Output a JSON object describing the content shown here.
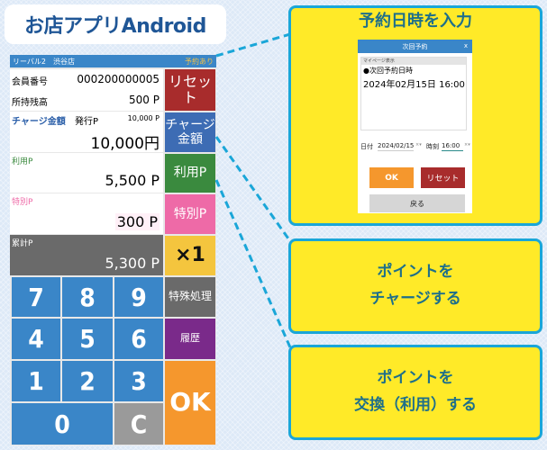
{
  "title": "お店アプリAndroid",
  "app": {
    "header": {
      "store": "リーバル2　渋谷店",
      "badge": "予約あり"
    },
    "member": {
      "member_no_label": "会員番号",
      "member_no": "000200000005",
      "balance_label": "所持残高",
      "balance": "500 P"
    },
    "charge": {
      "label": "チャージ金額",
      "issued_label": "発行P",
      "issued_value": "10,000 P",
      "amount": "10,000円"
    },
    "use": {
      "label": "利用P",
      "value": "5,500 P"
    },
    "special": {
      "label": "特別P",
      "value": "300 P"
    },
    "total": {
      "label": "累計P",
      "value": "5,300 P"
    },
    "side_buttons": {
      "reset": "リセット",
      "charge_line1": "チャージ",
      "charge_line2": "金額",
      "use": "利用P",
      "special": "特別P",
      "multiplier": "×1",
      "special_processing": "特殊処理",
      "history": "履歴",
      "ok": "OK"
    },
    "keypad": [
      "7",
      "8",
      "9",
      "4",
      "5",
      "6",
      "1",
      "2",
      "3",
      "0",
      "C"
    ]
  },
  "callouts": {
    "reservation": {
      "title": "予約日時を入力",
      "dialog": {
        "title": "次回予約",
        "close": "x",
        "caption": "マイページ表示",
        "line1": "●次回予約日時",
        "line2": "2024年02月15日 16:00",
        "date_label": "日付",
        "date_value": "2024/02/15",
        "date_clear": "×▾",
        "time_label": "時刻",
        "time_value": "16:00",
        "time_clear": "×▾",
        "ok": "OK",
        "reset": "リセット",
        "back": "戻る"
      }
    },
    "charge": {
      "line1": "ポイントを",
      "line2": "チャージする"
    },
    "exchange": {
      "line1": "ポイントを",
      "line2": "交換（利用）する"
    }
  },
  "colors": {
    "brand_blue": "#3a86c8",
    "reset_red": "#a82c2c",
    "charge_blue": "#3d6cb4",
    "use_green": "#3a8a3e",
    "special_pink": "#ee6aa7",
    "multiplier_yellow": "#f4c53e",
    "gray": "#6a6a6a",
    "history_purple": "#7a2a8a",
    "ok_orange": "#f5972d",
    "callout_yellow": "#ffea28",
    "callout_border": "#1aa6d8"
  }
}
